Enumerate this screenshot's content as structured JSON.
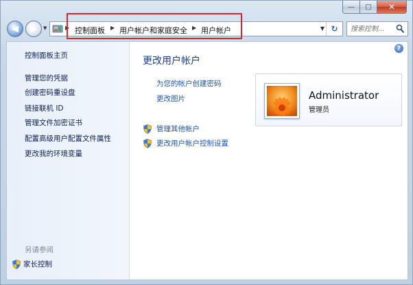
{
  "window": {
    "caption_buttons": {
      "minimize": "—",
      "maximize": "□",
      "close": "✕"
    }
  },
  "nav": {
    "back_glyph": "◀",
    "forward_glyph": "▶",
    "breadcrumbs": [
      "控制面板",
      "用户帐户和家庭安全",
      "用户帐户"
    ],
    "refresh_glyph": "↻",
    "dropdown_glyph": "▼",
    "search_placeholder": "搜索控制...",
    "highlight_color": "#e2212b"
  },
  "sidebar": {
    "home": "控制面板主页",
    "links": [
      "管理您的凭据",
      "创建密码重设盘",
      "链接联机 ID",
      "管理文件加密证书",
      "配置高级用户配置文件属性",
      "更改我的环境变量"
    ],
    "see_also": "另请参阅",
    "parental_controls": "家长控制"
  },
  "main": {
    "help_glyph": "?",
    "title": "更改用户帐户",
    "tasks": [
      "为您的帐户创建密码",
      "更改图片"
    ],
    "shield_tasks": [
      "管理其他帐户",
      "更改用户帐户控制设置"
    ],
    "account": {
      "name": "Administrator",
      "role": "管理员",
      "avatar": "orange-flower-picture"
    }
  },
  "icons": [
    "back-arrow-icon",
    "forward-arrow-icon",
    "control-panel-icon",
    "refresh-icon",
    "search-icon",
    "help-icon",
    "uac-shield-icon"
  ]
}
